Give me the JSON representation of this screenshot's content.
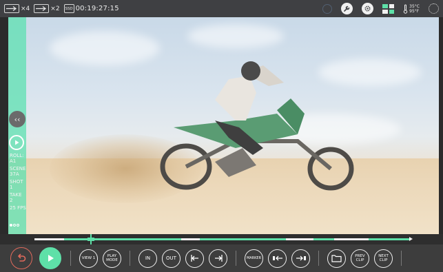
{
  "topbar": {
    "speed_fwd_a": "×4",
    "speed_fwd_b": "×2",
    "media_label": "SSD",
    "timecode": "00:19:27:15",
    "temperature": {
      "celsius": "35°C",
      "fahrenheit": "95°F"
    },
    "icons": [
      "arrow-right-icon",
      "arrow-right-icon",
      "ssd-icon",
      "wrench-icon",
      "gear-icon",
      "layout-grid-icon",
      "thermometer-icon",
      "fullscreen-icon"
    ]
  },
  "sidebar": {
    "collapse_glyph": "‹‹",
    "meta": {
      "roll_label": "ROLL:",
      "roll_value": "A1",
      "scene_label": "SCENE",
      "scene_value": "37A",
      "shot_label": "SHOT",
      "shot_value": "1",
      "take_label": "TAKE",
      "take_value": "2",
      "fps": "25 FPS"
    },
    "page_dots": 3,
    "active_dot": 0
  },
  "timeline": {
    "position_fraction": 0.15,
    "accent_color": "#5ee0a8"
  },
  "controls": {
    "view": "VIEW 1",
    "play_mode": "PLAY MODE",
    "in": "IN",
    "out": "OUT",
    "marker": "MARKER",
    "prev_clip": "PREV CLIP",
    "next_clip": "NEXT CLIP",
    "colors": {
      "undo": "#e06a5c",
      "play": "#5ee0a8"
    }
  }
}
